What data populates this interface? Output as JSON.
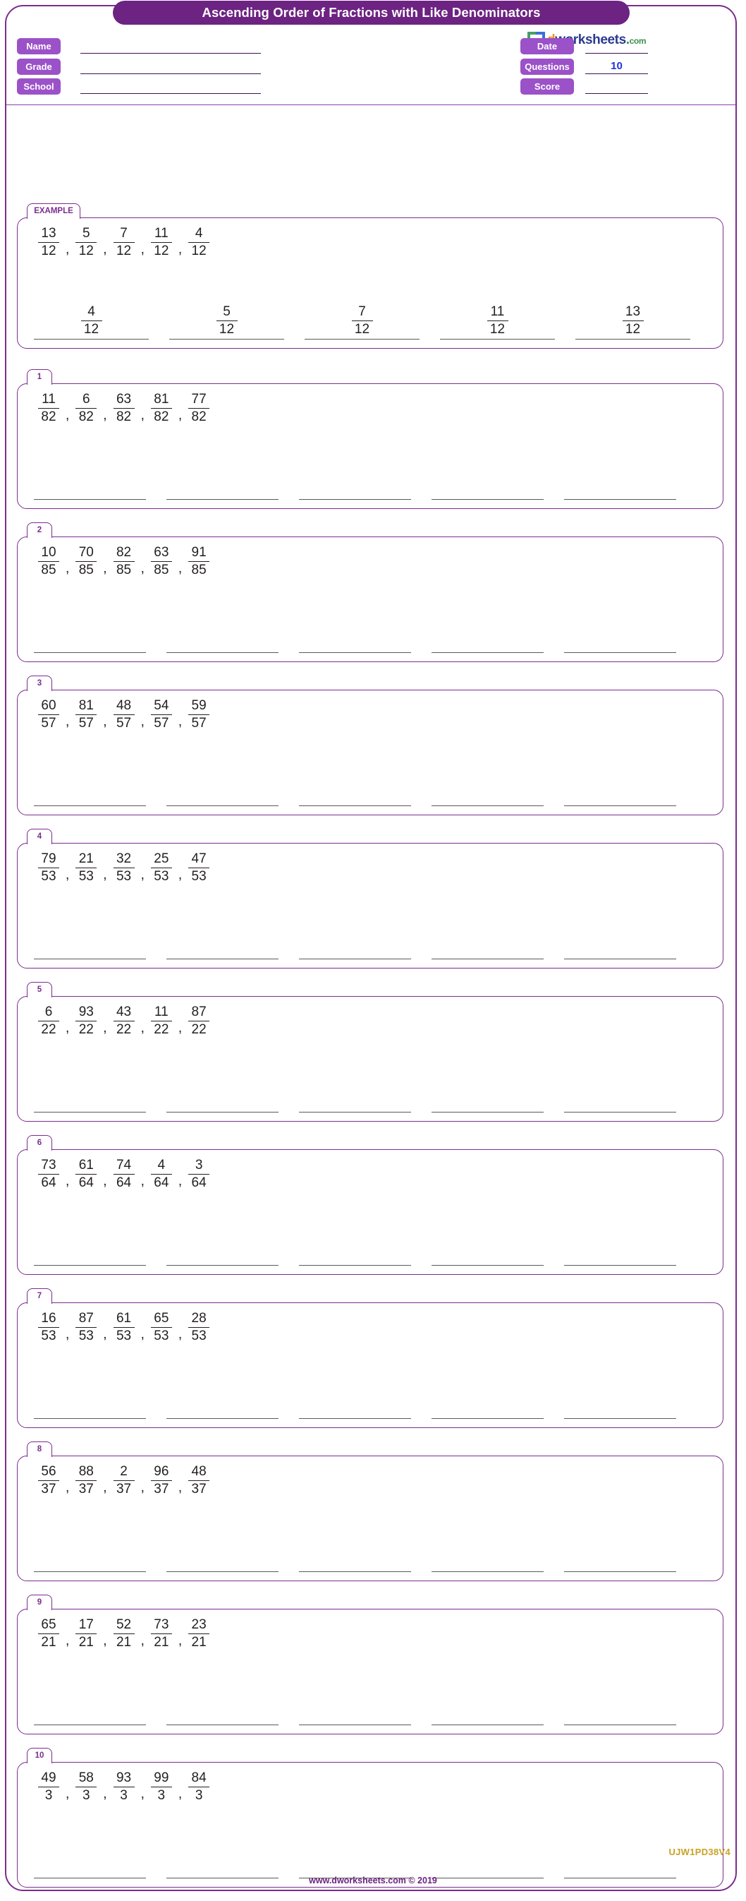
{
  "header": {
    "title": "Ascending Order of Fractions with Like Denominators",
    "logo": {
      "mark": "infinity-square-icon",
      "d": "d",
      "word": "worksheets",
      "dot": ".",
      "com": "com"
    },
    "fields_left": [
      {
        "label": "Name",
        "value": ""
      },
      {
        "label": "Grade",
        "value": ""
      },
      {
        "label": "School",
        "value": ""
      }
    ],
    "fields_right": [
      {
        "label": "Date",
        "value": ""
      },
      {
        "label": "Questions",
        "value": "10"
      },
      {
        "label": "Score",
        "value": ""
      }
    ]
  },
  "example": {
    "tab": "EXAMPLE",
    "fractions": [
      {
        "n": "13",
        "d": "12"
      },
      {
        "n": "5",
        "d": "12"
      },
      {
        "n": "7",
        "d": "12"
      },
      {
        "n": "11",
        "d": "12"
      },
      {
        "n": "4",
        "d": "12"
      }
    ],
    "answers": [
      {
        "n": "4",
        "d": "12"
      },
      {
        "n": "5",
        "d": "12"
      },
      {
        "n": "7",
        "d": "12"
      },
      {
        "n": "11",
        "d": "12"
      },
      {
        "n": "13",
        "d": "12"
      }
    ]
  },
  "problems": [
    {
      "tab": "1",
      "fractions": [
        {
          "n": "11",
          "d": "82"
        },
        {
          "n": "6",
          "d": "82"
        },
        {
          "n": "63",
          "d": "82"
        },
        {
          "n": "81",
          "d": "82"
        },
        {
          "n": "77",
          "d": "82"
        }
      ]
    },
    {
      "tab": "2",
      "fractions": [
        {
          "n": "10",
          "d": "85"
        },
        {
          "n": "70",
          "d": "85"
        },
        {
          "n": "82",
          "d": "85"
        },
        {
          "n": "63",
          "d": "85"
        },
        {
          "n": "91",
          "d": "85"
        }
      ]
    },
    {
      "tab": "3",
      "fractions": [
        {
          "n": "60",
          "d": "57"
        },
        {
          "n": "81",
          "d": "57"
        },
        {
          "n": "48",
          "d": "57"
        },
        {
          "n": "54",
          "d": "57"
        },
        {
          "n": "59",
          "d": "57"
        }
      ]
    },
    {
      "tab": "4",
      "fractions": [
        {
          "n": "79",
          "d": "53"
        },
        {
          "n": "21",
          "d": "53"
        },
        {
          "n": "32",
          "d": "53"
        },
        {
          "n": "25",
          "d": "53"
        },
        {
          "n": "47",
          "d": "53"
        }
      ]
    },
    {
      "tab": "5",
      "fractions": [
        {
          "n": "6",
          "d": "22"
        },
        {
          "n": "93",
          "d": "22"
        },
        {
          "n": "43",
          "d": "22"
        },
        {
          "n": "11",
          "d": "22"
        },
        {
          "n": "87",
          "d": "22"
        }
      ]
    },
    {
      "tab": "6",
      "fractions": [
        {
          "n": "73",
          "d": "64"
        },
        {
          "n": "61",
          "d": "64"
        },
        {
          "n": "74",
          "d": "64"
        },
        {
          "n": "4",
          "d": "64"
        },
        {
          "n": "3",
          "d": "64"
        }
      ]
    },
    {
      "tab": "7",
      "fractions": [
        {
          "n": "16",
          "d": "53"
        },
        {
          "n": "87",
          "d": "53"
        },
        {
          "n": "61",
          "d": "53"
        },
        {
          "n": "65",
          "d": "53"
        },
        {
          "n": "28",
          "d": "53"
        }
      ]
    },
    {
      "tab": "8",
      "fractions": [
        {
          "n": "56",
          "d": "37"
        },
        {
          "n": "88",
          "d": "37"
        },
        {
          "n": "2",
          "d": "37"
        },
        {
          "n": "96",
          "d": "37"
        },
        {
          "n": "48",
          "d": "37"
        }
      ]
    },
    {
      "tab": "9",
      "fractions": [
        {
          "n": "65",
          "d": "21"
        },
        {
          "n": "17",
          "d": "21"
        },
        {
          "n": "52",
          "d": "21"
        },
        {
          "n": "73",
          "d": "21"
        },
        {
          "n": "23",
          "d": "21"
        }
      ]
    },
    {
      "tab": "10",
      "fractions": [
        {
          "n": "49",
          "d": "3"
        },
        {
          "n": "58",
          "d": "3"
        },
        {
          "n": "93",
          "d": "3"
        },
        {
          "n": "99",
          "d": "3"
        },
        {
          "n": "84",
          "d": "3"
        }
      ]
    }
  ],
  "footer": {
    "site": "www.dworksheets.com © 2019",
    "code": "UJW1PD38V4"
  },
  "colors": {
    "title_bg": "#6d2382",
    "frame": "#7b2d8e",
    "label_badge": "#9b51c8",
    "value_blue": "#1e35d8",
    "code_gold": "#c9a227"
  }
}
